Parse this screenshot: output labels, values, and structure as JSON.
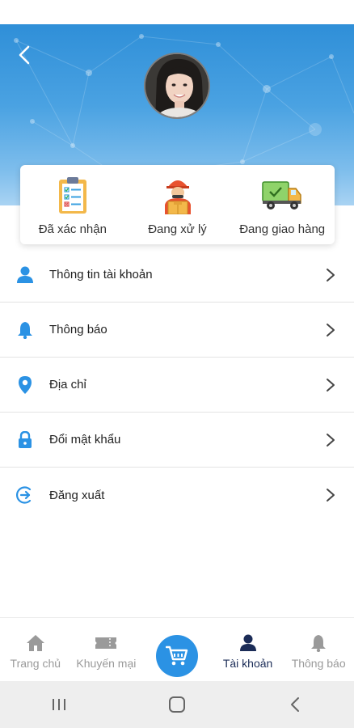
{
  "header": {
    "back_icon": "chevron-left-icon",
    "avatar": "profile-photo"
  },
  "order_status": [
    {
      "label": "Đã xác nhận",
      "icon": "clipboard-checklist-icon"
    },
    {
      "label": "Đang xử lý",
      "icon": "delivery-person-icon"
    },
    {
      "label": "Đang giao hàng",
      "icon": "delivery-truck-icon"
    }
  ],
  "menu": [
    {
      "label": "Thông tin tài khoản",
      "icon": "user-icon"
    },
    {
      "label": "Thông báo",
      "icon": "bell-icon"
    },
    {
      "label": "Địa chỉ",
      "icon": "location-pin-icon"
    },
    {
      "label": "Đổi mật khẩu",
      "icon": "lock-icon"
    },
    {
      "label": "Đăng xuất",
      "icon": "logout-icon"
    }
  ],
  "bottom_nav": {
    "home": "Trang chủ",
    "promo": "Khuyến mại",
    "account": "Tài khoản",
    "notifications": "Thông báo"
  },
  "colors": {
    "accent": "#2b92e4",
    "active_nav": "#1b2c57",
    "inactive_nav": "#9a9a9a"
  }
}
